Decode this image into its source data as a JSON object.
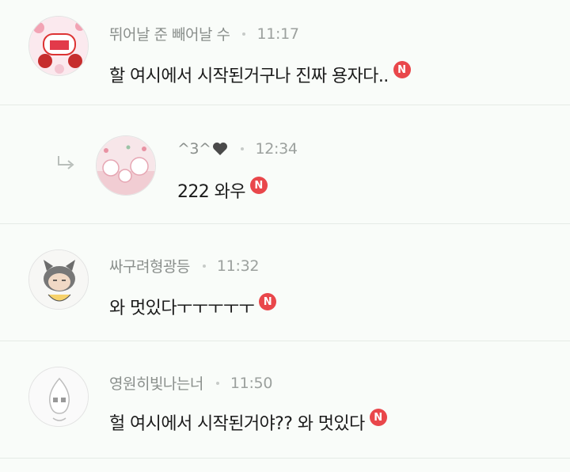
{
  "comments": [
    {
      "nick": "뛰어날 준 빼어날 수",
      "time": "11:17",
      "text": "할 여시에서 시작된거구나 진짜 용자다..",
      "badge": "N"
    },
    {
      "nick": "^3^",
      "time": "12:34",
      "text": "222 와우",
      "badge": "N",
      "is_reply": true
    },
    {
      "nick": "싸구려형광등",
      "time": "11:32",
      "text": "와 멋있다ㅜㅜㅜㅜㅜ",
      "badge": "N"
    },
    {
      "nick": "영원히빛나는너",
      "time": "11:50",
      "text": "헐 여시에서 시작된거야?? 와 멋있다",
      "badge": "N"
    }
  ],
  "colors": {
    "badge": "#e9474b",
    "nick": "#8a8f8c",
    "time": "#9ca19e",
    "text": "#1b1b1b",
    "background": "#f9fcf9"
  },
  "icons": {
    "reply": "reply-arrow-icon",
    "heart": "heart-icon",
    "new": "new-badge-icon"
  }
}
